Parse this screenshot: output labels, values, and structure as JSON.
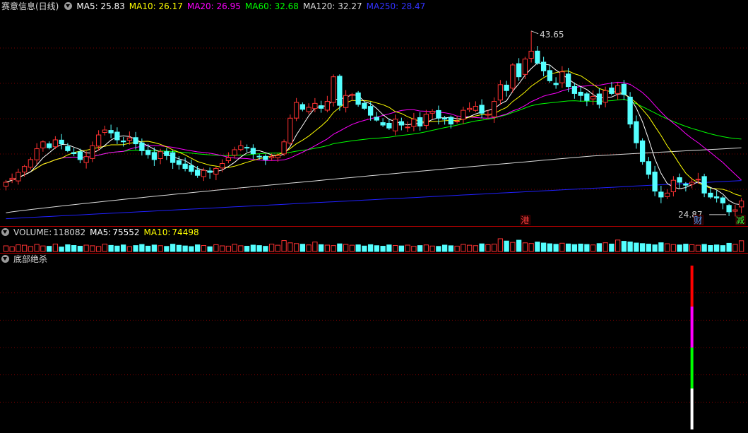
{
  "main_header": {
    "title": "赛意信息(日线)",
    "ma": [
      {
        "label": "MA5:",
        "value": "25.83",
        "color": "#ffffff"
      },
      {
        "label": "MA10:",
        "value": "26.17",
        "color": "#ffff00"
      },
      {
        "label": "MA20:",
        "value": "26.95",
        "color": "#ff00ff"
      },
      {
        "label": "MA60:",
        "value": "32.68",
        "color": "#00ff00"
      },
      {
        "label": "MA120:",
        "value": "32.27",
        "color": "#dcdcdc"
      },
      {
        "label": "MA250:",
        "value": "28.47",
        "color": "#3232ff"
      }
    ]
  },
  "volume_header": {
    "label": "VOLUME:",
    "value": "118082",
    "ma5_label": "MA5:",
    "ma5_value": "75552",
    "ma10_label": "MA10:",
    "ma10_value": "74498"
  },
  "indicator_header": {
    "title": "底部绝杀"
  },
  "annotations": {
    "high_label": "43.65",
    "low_label": "24.87",
    "markers": [
      {
        "text": "港",
        "color": "#ff3c3c"
      },
      {
        "text": "财",
        "color": "#5aa0ff"
      },
      {
        "text": "减",
        "color": "#3cff3c"
      }
    ]
  },
  "colors": {
    "up": "#ff3232",
    "down": "#54ffff",
    "ma5": "#ffffff",
    "ma10": "#ffff00",
    "ma20": "#ff00ff",
    "ma60": "#00ff00",
    "ma120": "#dcdcdc",
    "ma250": "#2020ff",
    "grid": "#7a0000"
  },
  "chart_data": {
    "type": "candlestick",
    "price_range": [
      24.0,
      45.5
    ],
    "high": 43.65,
    "low": 24.87,
    "closes": [
      28.3,
      28.7,
      29.3,
      29.9,
      30.6,
      31.7,
      32.4,
      31.8,
      32.6,
      32.2,
      31.5,
      31.2,
      30.6,
      30.9,
      32.0,
      33.1,
      33.6,
      33.3,
      32.6,
      32.4,
      32.8,
      32.2,
      31.5,
      31.1,
      30.6,
      31.4,
      31.0,
      30.3,
      30.1,
      29.7,
      29.4,
      29.0,
      29.5,
      29.3,
      29.7,
      30.2,
      30.8,
      31.6,
      32.0,
      31.8,
      31.2,
      30.9,
      30.6,
      30.9,
      31.0,
      32.4,
      34.8,
      36.4,
      35.7,
      35.9,
      36.3,
      35.8,
      36.5,
      39.0,
      36.1,
      37.1,
      37.2,
      36.2,
      35.8,
      35.1,
      34.6,
      34.1,
      33.8,
      34.7,
      34.1,
      33.9,
      34.7,
      34.0,
      35.2,
      35.5,
      34.8,
      34.7,
      34.2,
      34.5,
      35.6,
      35.8,
      36.0,
      35.3,
      35.2,
      36.5,
      38.2,
      37.6,
      40.2,
      39.0,
      40.8,
      41.6,
      40.4,
      39.6,
      38.6,
      38.2,
      39.5,
      38.0,
      37.3,
      37.1,
      36.6,
      37.0,
      36.2,
      37.6,
      37.3,
      38.1,
      37.2,
      34.2,
      32.3,
      30.4,
      29.1,
      27.4,
      26.8,
      27.2,
      28.5,
      28.3,
      28.0,
      28.3,
      28.6,
      27.2,
      26.8,
      26.7,
      26.2,
      25.3,
      25.5,
      26.4
    ],
    "volume": [
      6200,
      5100,
      7300,
      6900,
      5400,
      7800,
      6100,
      5700,
      8200,
      4900,
      7400,
      6600,
      5800,
      7000,
      6300,
      5500,
      8100,
      6700,
      6000,
      7200,
      5300,
      6500,
      7700,
      5900,
      7100,
      6400,
      5600,
      8000,
      6800,
      6100,
      5400,
      7300,
      6600,
      5200,
      7500,
      6200,
      5900,
      7900,
      6300,
      5800,
      7000,
      6500,
      5700,
      8100,
      6900,
      12000,
      9500,
      8700,
      8000,
      7200,
      10400,
      7500,
      7000,
      6500,
      8400,
      7800,
      6900,
      7300,
      6000,
      7500,
      6400,
      5800,
      7200,
      6600,
      6100,
      7000,
      5800,
      6500,
      7200,
      6000,
      5600,
      7000,
      6300,
      5900,
      7800,
      6900,
      6400,
      8400,
      7500,
      8100,
      14000,
      11500,
      10000,
      12400,
      9500,
      8800,
      10400,
      9300,
      8500,
      7900,
      9100,
      8300,
      7600,
      8200,
      7700,
      7200,
      8700,
      9600,
      8200,
      12600,
      11200,
      10500,
      9300,
      8700,
      8100,
      7300,
      9600,
      8500,
      7600,
      7200,
      8100,
      7400,
      6900,
      7800,
      6600,
      7200,
      6500,
      9000,
      7800,
      11800
    ],
    "indicator": [
      {
        "name": "",
        "color": "#ff0000",
        "from": 100,
        "to": 75
      },
      {
        "name": "",
        "color": "#ff00ff",
        "from": 75,
        "to": 50
      },
      {
        "name": "",
        "color": "#00ff00",
        "from": 50,
        "to": 25
      },
      {
        "name": "",
        "color": "#ffffff",
        "from": 25,
        "to": 0
      }
    ]
  }
}
